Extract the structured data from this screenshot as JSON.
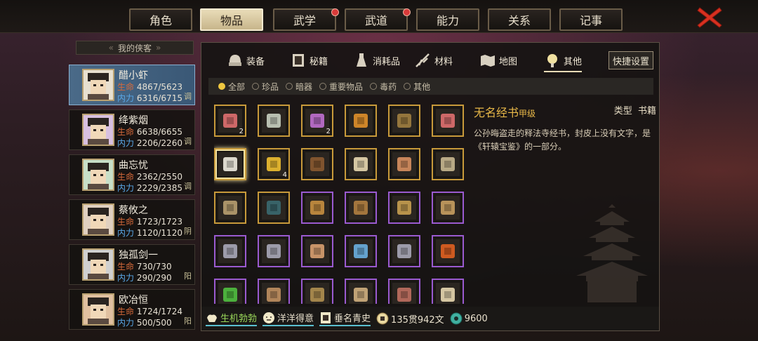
{
  "tabs": [
    {
      "label": "角色",
      "active": false,
      "badge": false
    },
    {
      "label": "物品",
      "active": true,
      "badge": false
    },
    {
      "label": "武学",
      "active": false,
      "badge": true
    },
    {
      "label": "武道",
      "active": false,
      "badge": true
    },
    {
      "label": "能力",
      "active": false,
      "badge": false
    },
    {
      "label": "关系",
      "active": false,
      "badge": false
    },
    {
      "label": "记事",
      "active": false,
      "badge": false
    }
  ],
  "sidebar": {
    "title": "我的侠客",
    "characters": [
      {
        "name": "醋小虾",
        "hp_label": "生命",
        "hp": "4867/5623",
        "mp_label": "内力",
        "mp": "6316/6715",
        "tag": "调",
        "selected": true
      },
      {
        "name": "绛紫烟",
        "hp_label": "生命",
        "hp": "6638/6655",
        "mp_label": "内力",
        "mp": "2206/2260",
        "tag": "调",
        "selected": false
      },
      {
        "name": "曲忘忧",
        "hp_label": "生命",
        "hp": "2362/2550",
        "mp_label": "内力",
        "mp": "2229/2385",
        "tag": "调",
        "selected": false
      },
      {
        "name": "蔡攸之",
        "hp_label": "生命",
        "hp": "1723/1723",
        "mp_label": "内力",
        "mp": "1120/1120",
        "tag": "阴",
        "selected": false
      },
      {
        "name": "独孤剑一",
        "hp_label": "生命",
        "hp": "730/730",
        "mp_label": "内力",
        "mp": "290/290",
        "tag": "阳",
        "selected": false
      },
      {
        "name": "欧冶恒",
        "hp_label": "生命",
        "hp": "1724/1724",
        "mp_label": "内力",
        "mp": "500/500",
        "tag": "阳",
        "selected": false
      }
    ]
  },
  "subtabs": [
    {
      "label": "装备",
      "icon": "helmet-icon"
    },
    {
      "label": "秘籍",
      "icon": "book-icon"
    },
    {
      "label": "消耗品",
      "icon": "potion-icon"
    },
    {
      "label": "材料",
      "icon": "material-icon"
    },
    {
      "label": "地图",
      "icon": "map-icon"
    },
    {
      "label": "其他",
      "icon": "lantern-icon",
      "active": true
    }
  ],
  "quick_setting": "快捷设置",
  "filters": [
    {
      "label": "全部",
      "on": true
    },
    {
      "label": "珍品",
      "on": false
    },
    {
      "label": "暗器",
      "on": false
    },
    {
      "label": "重要物品",
      "on": false
    },
    {
      "label": "毒药",
      "on": false
    },
    {
      "label": "其他",
      "on": false
    }
  ],
  "items": [
    {
      "icon": "key-icon",
      "rarity": "gold",
      "qty": "2",
      "color": "#e07070"
    },
    {
      "icon": "token-icon",
      "rarity": "gold",
      "qty": "",
      "color": "#c8d0c0"
    },
    {
      "icon": "crystal-icon",
      "rarity": "gold",
      "qty": "2",
      "color": "#c070d0"
    },
    {
      "icon": "feather-icon",
      "rarity": "gold",
      "qty": "",
      "color": "#e0902a"
    },
    {
      "icon": "bundle-icon",
      "rarity": "gold",
      "qty": "",
      "color": "#a08040"
    },
    {
      "icon": "key-icon",
      "rarity": "gold",
      "qty": "",
      "color": "#e07070"
    },
    {
      "icon": "scroll-icon",
      "rarity": "gold",
      "qty": "",
      "color": "#f0ece0",
      "selected": true
    },
    {
      "icon": "ingot-icon",
      "rarity": "gold",
      "qty": "4",
      "color": "#f0c030"
    },
    {
      "icon": "chest-icon",
      "rarity": "gold",
      "qty": "",
      "color": "#8a5a30"
    },
    {
      "icon": "tablet-icon",
      "rarity": "gold",
      "qty": "",
      "color": "#e8d8b0"
    },
    {
      "icon": "tablet-icon",
      "rarity": "gold",
      "qty": "",
      "color": "#d89060"
    },
    {
      "icon": "plaque-icon",
      "rarity": "gold",
      "qty": "",
      "color": "#c8b890"
    },
    {
      "icon": "plaque-icon",
      "rarity": "gold",
      "qty": "",
      "color": "#b8a070"
    },
    {
      "icon": "box-icon",
      "rarity": "gold",
      "qty": "",
      "color": "#3a6a70"
    },
    {
      "icon": "ring-icon",
      "rarity": "purple",
      "qty": "",
      "color": "#c89040"
    },
    {
      "icon": "ring-icon",
      "rarity": "purple",
      "qty": "",
      "color": "#b08040"
    },
    {
      "icon": "ring-icon",
      "rarity": "purple",
      "qty": "",
      "color": "#c8a050"
    },
    {
      "icon": "ring-icon",
      "rarity": "purple",
      "qty": "",
      "color": "#c8a060"
    },
    {
      "icon": "key-icon",
      "rarity": "purple",
      "qty": "",
      "color": "#a8a8b8"
    },
    {
      "icon": "key-icon",
      "rarity": "purple",
      "qty": "",
      "color": "#a8a8b8"
    },
    {
      "icon": "card-icon",
      "rarity": "purple",
      "qty": "",
      "color": "#d8a070"
    },
    {
      "icon": "letter-icon",
      "rarity": "purple",
      "qty": "",
      "color": "#6ab0e0"
    },
    {
      "icon": "key-icon",
      "rarity": "purple",
      "qty": "",
      "color": "#a8a8b8"
    },
    {
      "icon": "card-icon",
      "rarity": "purple",
      "qty": "",
      "color": "#e06020"
    },
    {
      "icon": "orb-icon",
      "rarity": "purple",
      "qty": "",
      "color": "#50c040"
    },
    {
      "icon": "pouch-icon",
      "rarity": "purple",
      "qty": "",
      "color": "#c09060"
    },
    {
      "icon": "bottle-icon",
      "rarity": "purple",
      "qty": "",
      "color": "#b09050"
    },
    {
      "icon": "pouch-icon",
      "rarity": "purple",
      "qty": "",
      "color": "#d0b080"
    },
    {
      "icon": "pouch-icon",
      "rarity": "purple",
      "qty": "",
      "color": "#c07060"
    },
    {
      "icon": "tablet-icon",
      "rarity": "purple",
      "qty": "",
      "color": "#e8d8b0"
    }
  ],
  "detail": {
    "name": "无名经书",
    "grade": "甲级",
    "type_label": "类型",
    "type_value": "书籍",
    "description": "公孙晦盗走的释法寺经书，封皮上没有文字，是《轩辕宝鉴》的一部分。"
  },
  "bottom": {
    "stat1": "生机勃勃",
    "stat2": "洋洋得意",
    "stat3": "垂名青史",
    "money": "135贯942文",
    "jade": "9600"
  }
}
